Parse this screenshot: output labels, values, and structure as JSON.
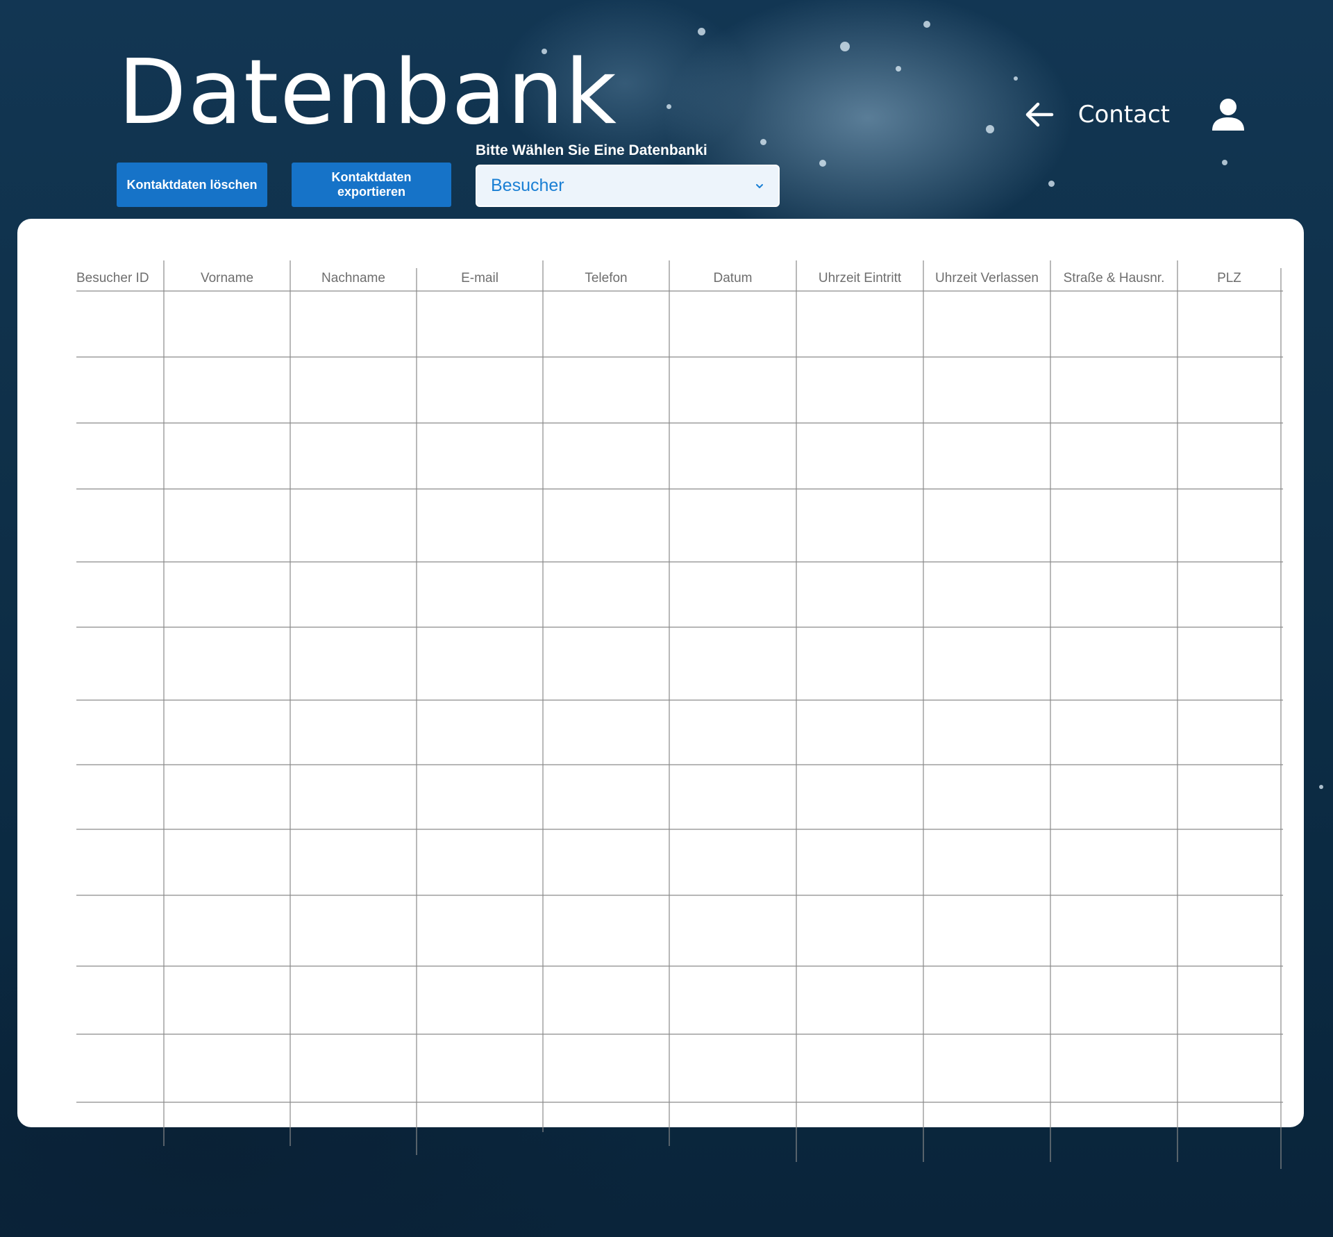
{
  "header": {
    "title": "Datenbank",
    "nav": {
      "back_icon": "arrow-left-icon",
      "contact_label": "Contact",
      "user_icon": "user-icon"
    }
  },
  "toolbar": {
    "delete_label": "Kontaktdaten löschen",
    "export_label": "Kontaktdaten exportieren",
    "select_label": "Bitte Wählen Sie Eine Datenbanki",
    "select_value": "Besucher",
    "select_icon": "chevron-down-icon"
  },
  "table": {
    "columns": [
      "Besucher ID",
      "Vorname",
      "Nachname",
      "E-mail",
      "Telefon",
      "Datum",
      "Uhrzeit Eintritt",
      "Uhrzeit Verlassen",
      "Straße & Hausnr.",
      "PLZ"
    ],
    "rows": [
      [
        "",
        "",
        "",
        "",
        "",
        "",
        "",
        "",
        "",
        ""
      ],
      [
        "",
        "",
        "",
        "",
        "",
        "",
        "",
        "",
        "",
        ""
      ],
      [
        "",
        "",
        "",
        "",
        "",
        "",
        "",
        "",
        "",
        ""
      ],
      [
        "",
        "",
        "",
        "",
        "",
        "",
        "",
        "",
        "",
        ""
      ],
      [
        "",
        "",
        "",
        "",
        "",
        "",
        "",
        "",
        "",
        ""
      ],
      [
        "",
        "",
        "",
        "",
        "",
        "",
        "",
        "",
        "",
        ""
      ],
      [
        "",
        "",
        "",
        "",
        "",
        "",
        "",
        "",
        "",
        ""
      ],
      [
        "",
        "",
        "",
        "",
        "",
        "",
        "",
        "",
        "",
        ""
      ],
      [
        "",
        "",
        "",
        "",
        "",
        "",
        "",
        "",
        "",
        ""
      ],
      [
        "",
        "",
        "",
        "",
        "",
        "",
        "",
        "",
        "",
        ""
      ],
      [
        "",
        "",
        "",
        "",
        "",
        "",
        "",
        "",
        "",
        ""
      ],
      [
        "",
        "",
        "",
        "",
        "",
        "",
        "",
        "",
        "",
        ""
      ]
    ]
  },
  "colors": {
    "button": "#1673c8",
    "select_text": "#1a7fd4",
    "select_bg": "#edf4fb",
    "grid_line": "#8a8a8a",
    "header_text": "#6e6e6e",
    "card_bg": "#ffffff"
  }
}
